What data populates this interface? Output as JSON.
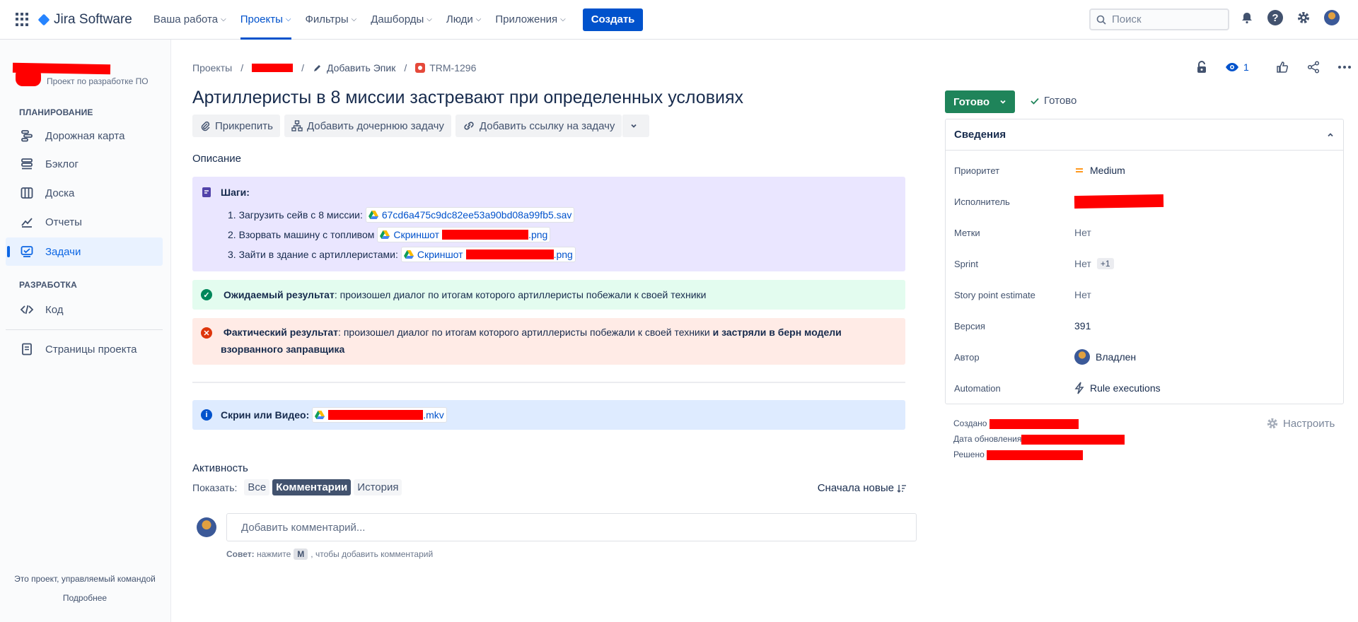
{
  "topnav": {
    "brand": "Jira Software",
    "items": [
      {
        "label": "Ваша работа",
        "active": false
      },
      {
        "label": "Проекты",
        "active": true
      },
      {
        "label": "Фильтры",
        "active": false
      },
      {
        "label": "Дашборды",
        "active": false
      },
      {
        "label": "Люди",
        "active": false
      },
      {
        "label": "Приложения",
        "active": false
      }
    ],
    "create_label": "Создать",
    "search_placeholder": "Поиск"
  },
  "sidebar": {
    "project_type": "Проект по разработке ПО",
    "planning_header": "ПЛАНИРОВАНИЕ",
    "planning_items": [
      "Дорожная карта",
      "Бэклог",
      "Доска",
      "Отчеты",
      "Задачи"
    ],
    "dev_header": "РАЗРАБОТКА",
    "dev_items": [
      "Код"
    ],
    "pages_label": "Страницы проекта",
    "footer_text": "Это проект, управляемый командой",
    "footer_link": "Подробнее"
  },
  "breadcrumbs": {
    "projects": "Проекты",
    "add_epic": "Добавить Эпик",
    "issue_key": "TRM-1296"
  },
  "issue": {
    "title": "Артиллеристы в 8 миссии застревают при определенных условиях",
    "actions": [
      "Прикрепить",
      "Добавить дочернюю задачу",
      "Добавить ссылку на задачу"
    ],
    "description_label": "Описание",
    "steps_title": "Шаги",
    "steps": [
      {
        "text": "1. Загрузить сейв с 8 миссии:",
        "file": "67cd6a475c9dc82ee53a90bd08a99fb5.sav"
      },
      {
        "text": "2. Взорвать машину с топливом",
        "file_prefix": "Скриншот",
        "file_suffix": ".png"
      },
      {
        "text": "3. Зайти в здание с артиллеристами:",
        "file_prefix": "Скриншот",
        "file_suffix": ".png"
      }
    ],
    "expected_label": "Ожидаемый результат",
    "expected_text": ": произошел диалог по итогам которого артиллеристы побежали к своей техники",
    "actual_label": "Фактический результат",
    "actual_text": ": произошел диалог по итогам которого артиллеристы побежали к своей техники ",
    "actual_bold": "и застряли в берн модели взорванного",
    "actual_bold2": "заправщика",
    "media_label": "Скрин или Видео",
    "media_suffix": ".mkv"
  },
  "activity": {
    "title": "Активность",
    "show_label": "Показать:",
    "tabs": [
      {
        "label": "Все",
        "selected": false
      },
      {
        "label": "Комментарии",
        "selected": true
      },
      {
        "label": "История",
        "selected": false
      }
    ],
    "sort_label": "Сначала новые",
    "comment_placeholder": "Добавить комментарий...",
    "tip_prefix": "Совет:",
    "tip_mid": "нажмите",
    "tip_key": "M",
    "tip_suffix": ", чтобы добавить комментарий"
  },
  "right": {
    "watch_count": "1",
    "status_label": "Готово",
    "resolution_label": "Готово",
    "details_title": "Сведения",
    "fields": {
      "priority_label": "Приоритет",
      "priority_value": "Medium",
      "assignee_label": "Исполнитель",
      "labels_label": "Метки",
      "labels_value": "Нет",
      "sprint_label": "Sprint",
      "sprint_value": "Нет",
      "sprint_extra": "+1",
      "estimate_label": "Story point estimate",
      "estimate_value": "Нет",
      "version_label": "Версия",
      "version_value": "391",
      "author_label": "Автор",
      "author_value": "Владлен",
      "automation_label": "Automation",
      "automation_value": "Rule executions"
    },
    "created_label": "Создано",
    "updated_label": "Дата обновления",
    "resolved_label": "Решено",
    "configure_label": "Настроить"
  }
}
